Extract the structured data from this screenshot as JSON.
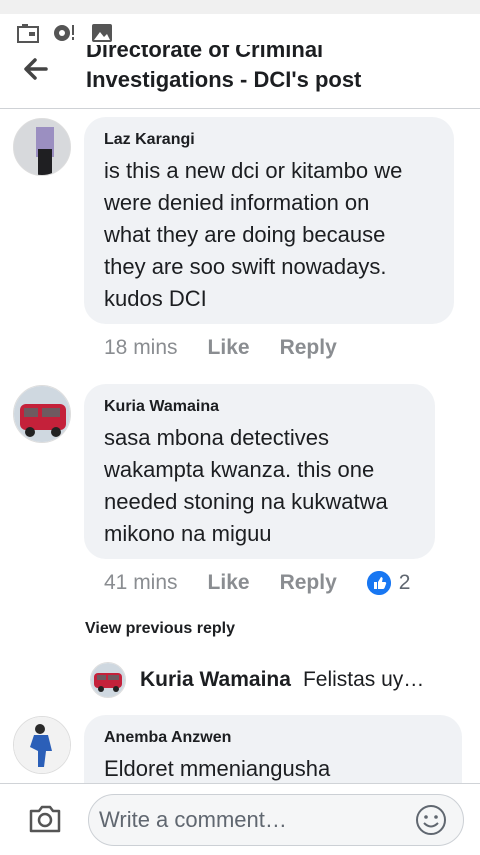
{
  "header": {
    "title_line1": "Directorate of Criminal",
    "title_line2": "Investigations - DCI's post"
  },
  "comments": [
    {
      "author": "Laz Karangi",
      "text_lines": [
        "is this a new dci or kitambo we",
        "were denied information on",
        "what they are doing because",
        "they are soo swift nowadays.",
        "kudos DCI"
      ],
      "time": "18 mins",
      "like_label": "Like",
      "reply_label": "Reply"
    },
    {
      "author": "Kuria Wamaina",
      "text_lines": [
        "sasa mbona detectives",
        "wakampta kwanza. this one",
        "needed stoning na kukwatwa",
        "mikono na miguu"
      ],
      "time": "41 mins",
      "like_label": "Like",
      "reply_label": "Reply",
      "reaction_count": "2"
    },
    {
      "author": "Anemba Anzwen",
      "text_lines": [
        "Eldoret mmeniangusha"
      ]
    }
  ],
  "view_previous_reply": "View previous reply",
  "reply_preview": {
    "author": "Kuria Wamaina",
    "text": "Felistas uy…"
  },
  "composer": {
    "placeholder": "Write a comment…"
  },
  "colors": {
    "accent": "#1877f2",
    "bubble": "#f0f2f5",
    "meta": "#8a8d91"
  }
}
